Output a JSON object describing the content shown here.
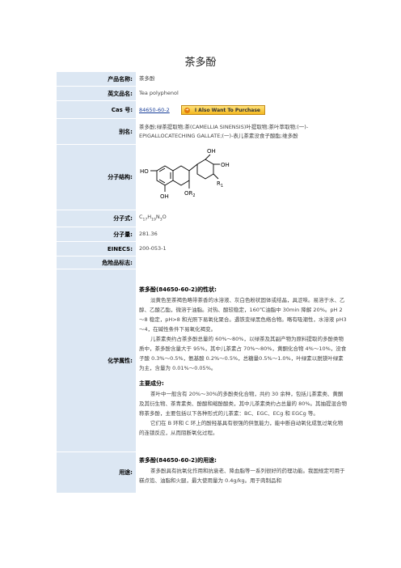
{
  "page_title": "茶多酚",
  "rows": {
    "product_name": {
      "label": "产品名称:",
      "value": "茶多酚"
    },
    "english_name": {
      "label": "英文品名:",
      "value": "Tea polyphenol"
    },
    "cas": {
      "label": "Cas 号:",
      "value": "84650-60-2",
      "button": "I Also Want To Purchase"
    },
    "alias": {
      "label": "别名:",
      "value": "茶多酚;绿茶提取物;茶(CAMELLIA SINENSIS)叶提取物;茶叶萃取物;(一)-EPIGALLOCATECHING GALLATE;(一)-表儿茶素没食子酸酯;维多酚"
    },
    "structure": {
      "label": "分子结构:",
      "labels": {
        "oh_top": "OH",
        "oh_right": "OH",
        "ho_left": "HO",
        "oh_bottom": "OH",
        "or2": "OR",
        "or2_sub": "2",
        "r1": "R",
        "r1_sub": "1"
      }
    },
    "formula": {
      "label": "分子式:",
      "c": "C",
      "c_n": "17",
      "h": "H",
      "h_n": "19",
      "n": "N",
      "n_n": "3",
      "o": "O"
    },
    "weight": {
      "label": "分子量:",
      "value": "281.36"
    },
    "einecs": {
      "label": "EINECS:",
      "value": "200-053-1"
    },
    "hazard": {
      "label": "危险品标志:",
      "value": ""
    },
    "properties": {
      "label": "化学属性:",
      "head1": "茶多酚(84650-60-2)的性状:",
      "p1": "淡黄色至茶褐色略带茶香的水溶液、灰白色粉状固体或结晶，具涩味。易溶于水、乙醇、乙酸乙酯，微溶于油脂。对热、酸较稳定，160℃油脂中 30min 降解 20%。pH 2～8 稳定，pH>8 和光照下易氧化聚合。遇铁变绿黑色络合物。略有吸潮性，水溶液 pH3～4，在碱性条件下易氧化褐变。",
      "p2": "儿茶素类约占茶多酚总量的 60%～80%，以绿茶及其副产物为原料提取的多酚类物质中，茶多酚含量大于 95%，其中儿茶素占 70%～80%，黄酮化合物 4%～10%，没食子酸 0.3%～0.5%，氨基酸 0.2%～0.5%，总糖量0.5%～1.0%，叶绿素以脱镁叶绿素为主，含量为 0.01%～0.05%。",
      "head2": "主要成分:",
      "p3": "茶叶中一般含有 20%～30%的多酚类化合物，共约 30 余种，包括儿茶素类、黄酮及其衍生物、茶青素类、酚酸和缩酚酸类，其中儿茶素类约占总量的 80%。其抽提混合物称茶多酚，主要包括以下各种形式的儿茶素：BC、EGC、ECg 和 EGCg 等。",
      "p4": "它们在 B 环和 C 环上的酚羟基具有很强的供氢能力，能中断自动氧化成氢过氧化物的连锁反应，从而阻断氧化过程。"
    },
    "uses": {
      "label": "用途:",
      "head": "茶多酚(84650-60-2)的用途:",
      "p1": "茶多酚具有抗氧化作用和抗衰老、降血脂等一系列很好的药理功能。我国规定可用于糕点馅、油脂和火腿，最大使用量为 0.4g/kg。用于肉制品和"
    }
  }
}
